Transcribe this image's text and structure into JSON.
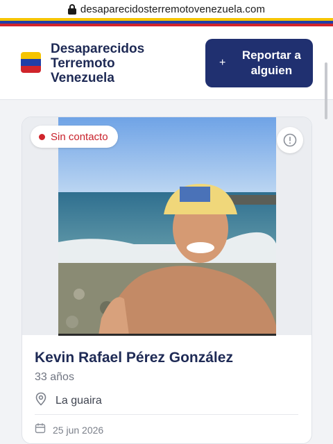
{
  "browser": {
    "url": "desaparecidosterremotovenezuela.com"
  },
  "colors": {
    "flag_yellow": "#f5c400",
    "flag_blue": "#1f3fa8",
    "flag_red": "#d0242b",
    "brand_navy": "#203070",
    "status_red": "#d0242b"
  },
  "header": {
    "site_title": "Desaparecidos Terremoto Venezuela",
    "report_button": {
      "icon": "plus-icon",
      "label": "Reportar a alguien"
    }
  },
  "card": {
    "status_badge": "Sin contacto",
    "info_icon": "info-circle-icon",
    "name": "Kevin Rafael Pérez González",
    "age": "33 años",
    "location_icon": "map-pin-icon",
    "location": "La guaira",
    "date_icon": "calendar-icon",
    "date": "25 jun 2026"
  }
}
